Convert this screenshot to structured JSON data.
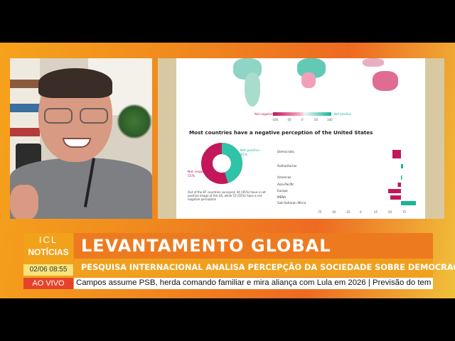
{
  "broadcast": {
    "logo": {
      "line1": "ICL",
      "line2": "NOTÍCIAS"
    },
    "date_time": "02/06 08:55",
    "live_badge": "AO VIVO",
    "headline": "LEVANTAMENTO GLOBAL",
    "subheadline": "PESQUISA INTERNACIONAL ANALISA PERCEPÇÃO DA SOCIEDADE SOBRE DEMOCRACIA",
    "ticker": "Campos assume PSB, herda comando familiar e mira aliança com Lula em 2026 |  Previsão do tem"
  },
  "colors": {
    "orange": "#ee7a1f",
    "amber": "#f0a01e",
    "live_red": "#e7432c",
    "net_negative": "#c2185b",
    "net_positive": "#1bb39a"
  },
  "slide": {
    "legend": {
      "left_label": "Net negative",
      "right_label": "Net positive",
      "ticks": [
        "-100",
        "-50",
        "0",
        "50",
        "100"
      ]
    },
    "heading": "Most countries have a negative perception of the United States",
    "donut": {
      "positive_label": "Net positive",
      "positive_value": "45%",
      "negative_label": "Net negative",
      "negative_value": "55%",
      "positive_fraction": 0.45
    },
    "caption": "Out of the 87 countries surveyed, 44 (45%) have a net positive image of the US, while 53 (55%) have a net negative perception",
    "regions": [
      {
        "name": "Democratic",
        "value": -8
      },
      {
        "name": "Authoritarian",
        "value": 2
      },
      {
        "name": "Americas",
        "value": 1
      },
      {
        "name": "Asia-Pacific",
        "value": -3
      },
      {
        "name": "Europe",
        "value": -12
      },
      {
        "name": "MENA",
        "value": -10
      },
      {
        "name": "Sub-Saharan Africa",
        "value": 14
      }
    ],
    "x_ticks": [
      "-75",
      "-50",
      "-25",
      "0",
      "25",
      "50",
      "75"
    ]
  }
}
